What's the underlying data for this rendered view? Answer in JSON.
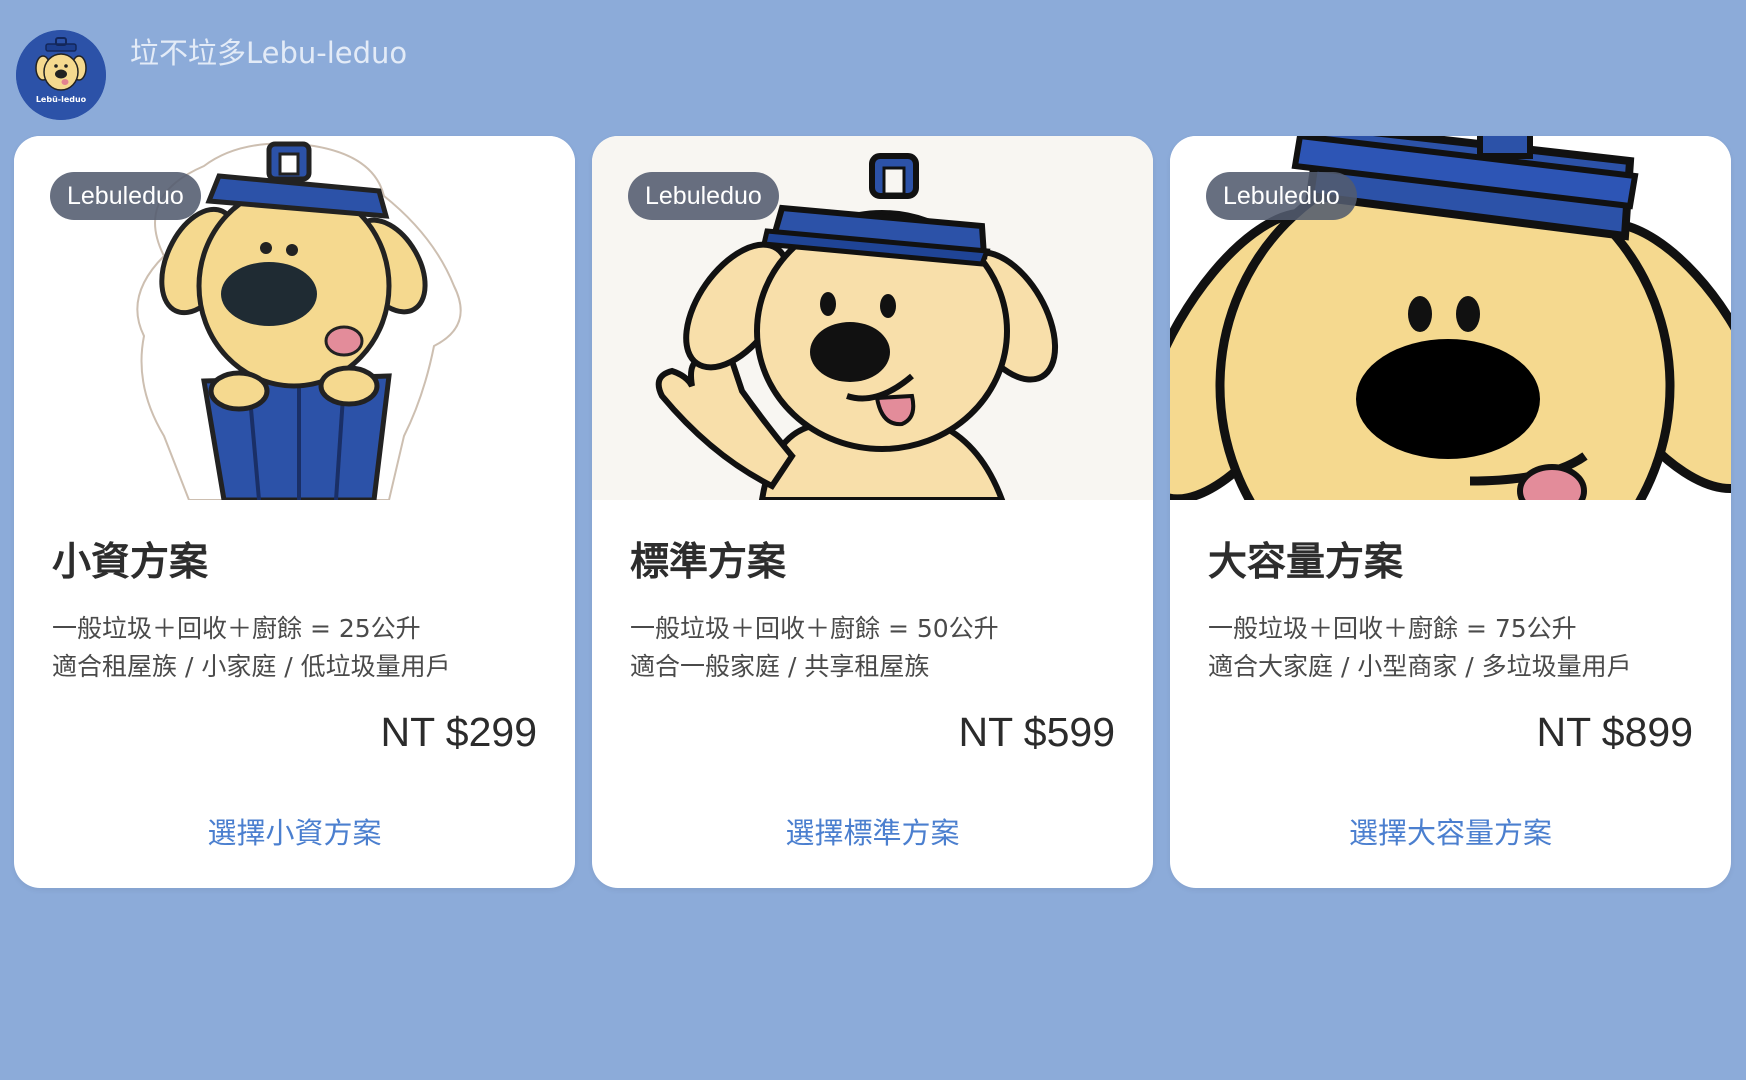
{
  "header": {
    "logo_text": "Lebü-leduo",
    "brand": "垃不垃多Lebu-leduo"
  },
  "colors": {
    "background": "#8cabd9",
    "card": "#ffffff",
    "accent_link": "#4b7fcf",
    "badge": "#525b6e",
    "mascot_fill": "#f5d98f",
    "bin_blue": "#2c52a8"
  },
  "plans": [
    {
      "badge": "Lebuleduo",
      "image_icon": "mascot-dog-in-trash-bin",
      "title": "小資方案",
      "desc_line1": "一般垃圾＋回收＋廚餘 = 25公升",
      "desc_line2": "適合租屋族 / 小家庭 / 低垃圾量用戶",
      "price": "NT $299",
      "action": "選擇小資方案"
    },
    {
      "badge": "Lebuleduo",
      "image_icon": "mascot-dog-waving",
      "title": "標準方案",
      "desc_line1": "一般垃圾＋回收＋廚餘 = 50公升",
      "desc_line2": "適合一般家庭 / 共享租屋族",
      "price": "NT $599",
      "action": "選擇標準方案"
    },
    {
      "badge": "Lebuleduo",
      "image_icon": "mascot-dog-closeup",
      "title": "大容量方案",
      "desc_line1": "一般垃圾＋回收＋廚餘 = 75公升",
      "desc_line2": "適合大家庭 / 小型商家 / 多垃圾量用戶",
      "price": "NT $899",
      "action": "選擇大容量方案"
    }
  ]
}
